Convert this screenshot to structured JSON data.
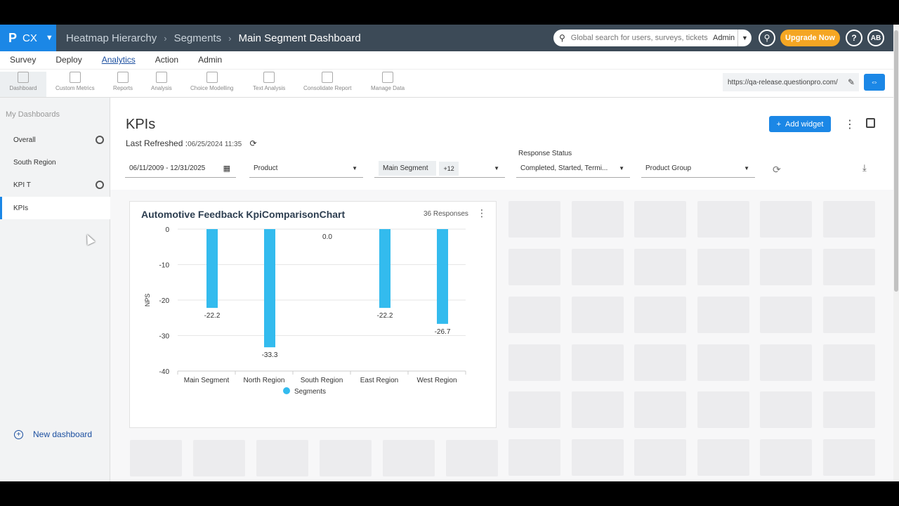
{
  "topbar": {
    "brand": "CX",
    "breadcrumbs": [
      "Heatmap Hierarchy",
      "Segments",
      "Main Segment Dashboard"
    ],
    "search_placeholder": "Global search for users, surveys, tickets",
    "search_scope": "Admin",
    "upgrade_label": "Upgrade Now",
    "help_label": "?",
    "avatar_initials": "AB"
  },
  "nav": [
    "Survey",
    "Deploy",
    "Analytics",
    "Action",
    "Admin"
  ],
  "toolbar": {
    "tools": [
      "Dashboard",
      "Custom Metrics",
      "Reports",
      "Analysis",
      "Choice Modelling",
      "Text Analysis",
      "Consolidate Report",
      "Manage Data"
    ],
    "url": "https://qa-release.questionpro.com/"
  },
  "sidebar": {
    "title": "My Dashboards",
    "items": [
      "Overall",
      "South Region",
      "KPI T",
      "KPIs"
    ],
    "new_dashboard": "New dashboard"
  },
  "main": {
    "title": "KPIs",
    "last_refreshed_label": "Last Refreshed :",
    "last_refreshed_value": "06/25/2024 11:35",
    "add_widget": "Add widget",
    "filters": {
      "date_range": "06/11/2009 - 12/31/2025",
      "product": "Product",
      "segment": "Main Segment",
      "segment_more": "+12",
      "response_status_label": "Response Status",
      "response_status": "Completed, Started, Termi...",
      "product_group": "Product Group"
    }
  },
  "widget": {
    "title": "Automotive Feedback KpiComparisonChart",
    "responses": "36 Responses"
  },
  "chart_data": {
    "type": "bar",
    "categories": [
      "Main Segment",
      "North Region",
      "South Region",
      "East Region",
      "West Region"
    ],
    "series": [
      {
        "name": "Segments",
        "values": [
          -22.2,
          -33.3,
          0.0,
          -22.2,
          -26.7
        ]
      }
    ],
    "value_labels": [
      "-22.2",
      "-33.3",
      "0.0",
      "-22.2",
      "-26.7"
    ],
    "ylabel": "NPS",
    "ylim": [
      -40,
      0
    ],
    "yticks": [
      "0",
      "-10",
      "-20",
      "-30",
      "-40"
    ],
    "grid": true,
    "legend": "bottom",
    "color": "#33bbee"
  }
}
